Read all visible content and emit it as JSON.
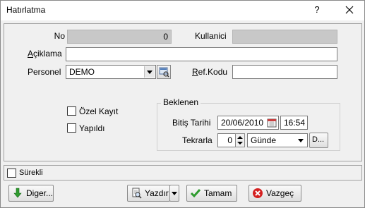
{
  "window": {
    "title": "Hatırlatma",
    "help_label": "?"
  },
  "form": {
    "no_label": "No",
    "no_value": "0",
    "kullanici_label": "Kullanici",
    "kullanici_value": "",
    "aciklama_label": "Açiklama",
    "aciklama_value": "",
    "personel_label": "Personel",
    "personel_value": "DEMO",
    "refkodu_label": "Ref.Kodu",
    "refkodu_value": ""
  },
  "checks": {
    "ozel_kayit_label": "Özel Kayıt",
    "ozel_kayit_checked": false,
    "yapildi_label": "Yapıldı",
    "yapildi_checked": false
  },
  "beklenen": {
    "group_title": "Beklenen",
    "bitis_tarihi_label": "Bitiş Tarihi",
    "bitis_tarihi_value": "20/06/2010",
    "bitis_saat_value": "16:54",
    "tekrarla_label": "Tekrarla",
    "tekrarla_value": "0",
    "period_value": "Günde",
    "d_button_label": "D..."
  },
  "footer": {
    "surekli_label": "Sürekli",
    "surekli_checked": false,
    "diger_label": "Diger...",
    "yazdir_label": "Yazdır",
    "tamam_label": "Tamam",
    "vazgec_label": "Vazgeç"
  },
  "colors": {
    "ok_green": "#2e9b2e",
    "cancel_red": "#d42020",
    "disabled_field": "#c8c8c8"
  }
}
